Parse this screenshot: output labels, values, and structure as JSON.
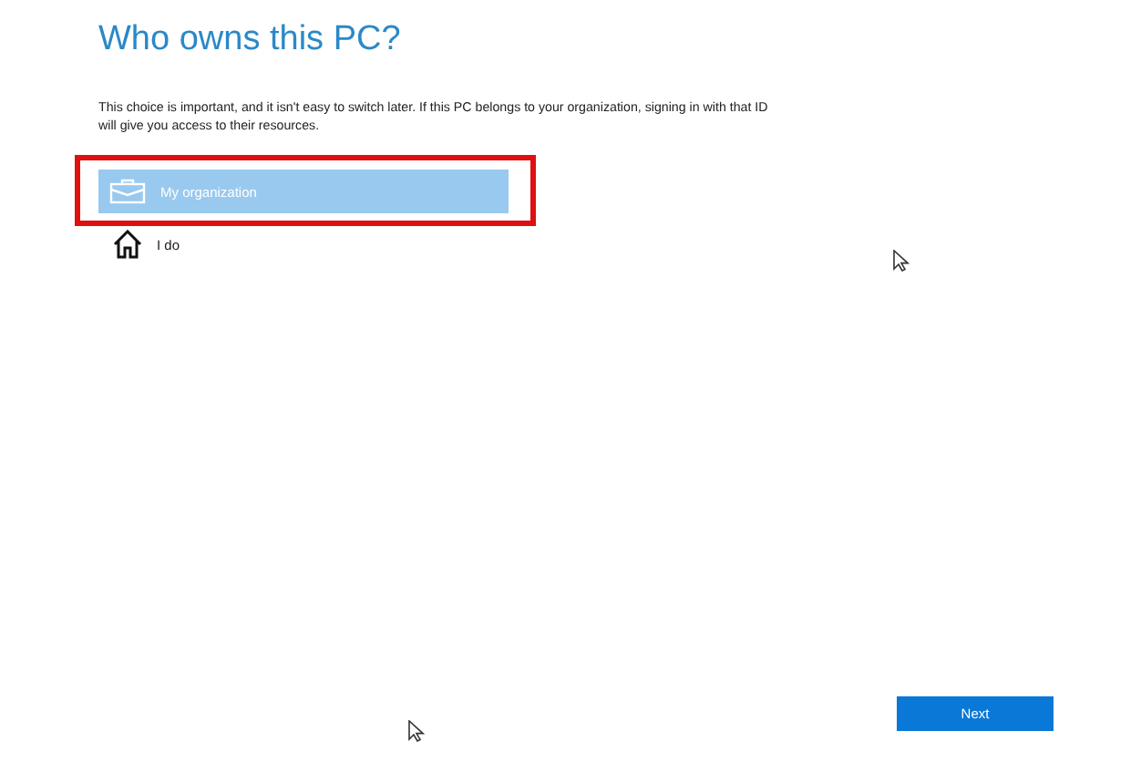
{
  "title": "Who owns this PC?",
  "description": "This choice is important, and it isn't easy to switch later. If this PC belongs to your organization, signing in with that ID will give you access to their resources.",
  "options": [
    {
      "label": "My organization",
      "kind": "briefcase",
      "selected": true,
      "highlighted": true
    },
    {
      "label": "I do",
      "kind": "home",
      "selected": false,
      "highlighted": false
    }
  ],
  "buttons": [
    {
      "label": "Next"
    }
  ]
}
